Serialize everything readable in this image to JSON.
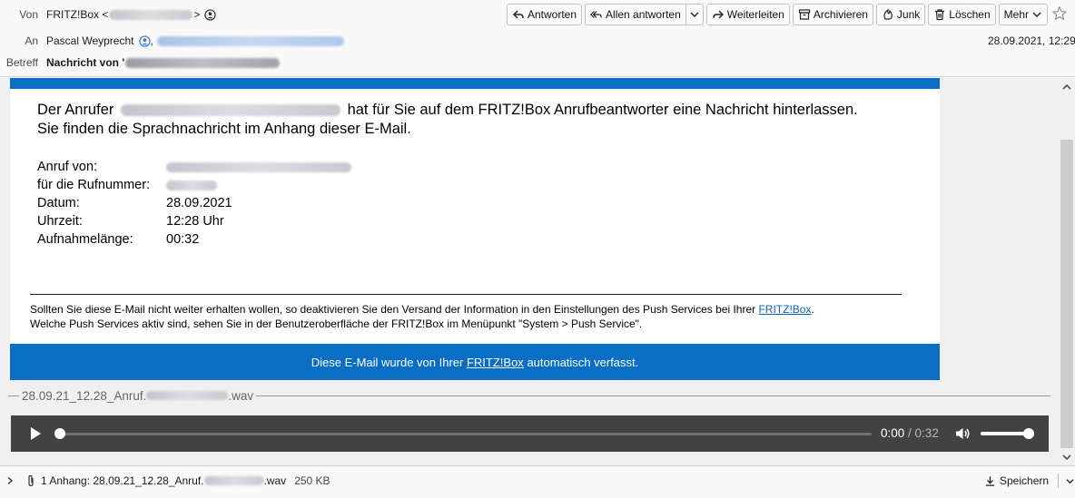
{
  "header": {
    "from_label": "Von",
    "from_name": "FRITZ!Box",
    "from_open": "<",
    "from_close": ">",
    "to_label": "An",
    "to_name": "Pascal Weyprecht",
    "to_separator": ",",
    "date": "28.09.2021, 12:29",
    "subject_label": "Betreff",
    "subject_text": "Nachricht von '"
  },
  "toolbar": {
    "reply": "Antworten",
    "reply_all": "Allen antworten",
    "forward": "Weiterleiten",
    "archive": "Archivieren",
    "junk": "Junk",
    "delete": "Löschen",
    "more": "Mehr"
  },
  "message": {
    "intro_line1_a": "Der Anrufer",
    "intro_line1_b": "hat für Sie auf dem FRITZ!Box Anrufbeantworter eine Nachricht hinterlassen.",
    "intro_line2": "Sie finden die Sprachnachricht im Anhang dieser E-Mail.",
    "details": {
      "caller_label": "Anruf von:",
      "number_label": "für die Rufnummer:",
      "date_label": "Datum:",
      "date_value": "28.09.2021",
      "time_label": "Uhrzeit:",
      "time_value": "12:28 Uhr",
      "length_label": "Aufnahmelänge:",
      "length_value": "00:32"
    },
    "footer_text_a": "Sollten Sie diese E-Mail nicht weiter erhalten wollen, so deaktivieren Sie den Versand der Information in den Einstellungen des Push Services bei Ihrer",
    "footer_link": "FRITZ!Box",
    "footer_text_b": ".",
    "footer_line2": "Welche Push Services aktiv sind, sehen Sie in der Benutzeroberfläche der FRITZ!Box im Menüpunkt \"System > Push Service\".",
    "banner_a": "Diese E-Mail wurde von Ihrer",
    "banner_link": "FRITZ!Box",
    "banner_b": "automatisch verfasst."
  },
  "attachment_inline": {
    "name_prefix": "28.09.21_12.28_Anruf.",
    "name_suffix": ".wav"
  },
  "player": {
    "current_time": "0:00",
    "separator": " / ",
    "duration": "0:32",
    "progress": 0,
    "volume": 1.0
  },
  "attachment_bar": {
    "summary_prefix": "1 Anhang: 28.09.21_12.28_Anruf.",
    "summary_suffix": ".wav",
    "size": "250 KB",
    "save_label": "Speichern"
  },
  "colors": {
    "brand_blue": "#0b6ec5",
    "player_bg": "#424242",
    "link": "#0b5fb8"
  },
  "icons": {
    "reply": "reply-icon",
    "reply_all": "reply-all-icon",
    "forward": "forward-icon",
    "archive": "archive-icon",
    "junk": "junk-icon",
    "delete": "trash-icon",
    "star": "star-icon",
    "play": "play-icon",
    "volume": "volume-icon",
    "attachment": "paperclip-icon",
    "save": "download-icon"
  }
}
